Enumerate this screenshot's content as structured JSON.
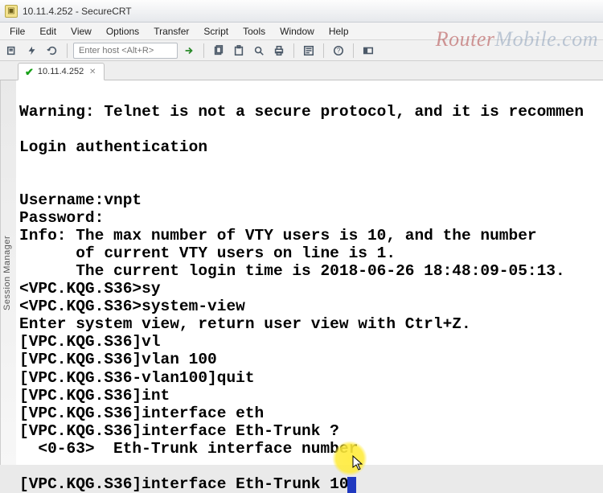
{
  "titlebar": {
    "text": "10.11.4.252 - SecureCRT"
  },
  "menubar": {
    "items": [
      "File",
      "Edit",
      "View",
      "Options",
      "Transfer",
      "Script",
      "Tools",
      "Window",
      "Help"
    ]
  },
  "toolbar": {
    "host_placeholder": "Enter host <Alt+R>"
  },
  "tabstrip": {
    "active_tab_label": "10.11.4.252"
  },
  "sidebar": {
    "label": "Session Manager"
  },
  "watermark": {
    "router": "Router",
    "mobile": "Mobile",
    "dotcom": ".com"
  },
  "terminal": {
    "lines": [
      "",
      "Warning: Telnet is not a secure protocol, and it is recommen",
      "",
      "Login authentication",
      "",
      "",
      "Username:vnpt",
      "Password:",
      "Info: The max number of VTY users is 10, and the number",
      "      of current VTY users on line is 1.",
      "      The current login time is 2018-06-26 18:48:09-05:13.",
      "<VPC.KQG.S36>sy",
      "<VPC.KQG.S36>system-view",
      "Enter system view, return user view with Ctrl+Z.",
      "[VPC.KQG.S36]vl",
      "[VPC.KQG.S36]vlan 100",
      "[VPC.KQG.S36-vlan100]quit",
      "[VPC.KQG.S36]int",
      "[VPC.KQG.S36]interface eth",
      "[VPC.KQG.S36]interface Eth-Trunk ?",
      "  <0-63>  Eth-Trunk interface number",
      ""
    ],
    "prompt_line_prefix": "[VPC.KQG.S36]interface Eth-Trunk 10"
  }
}
